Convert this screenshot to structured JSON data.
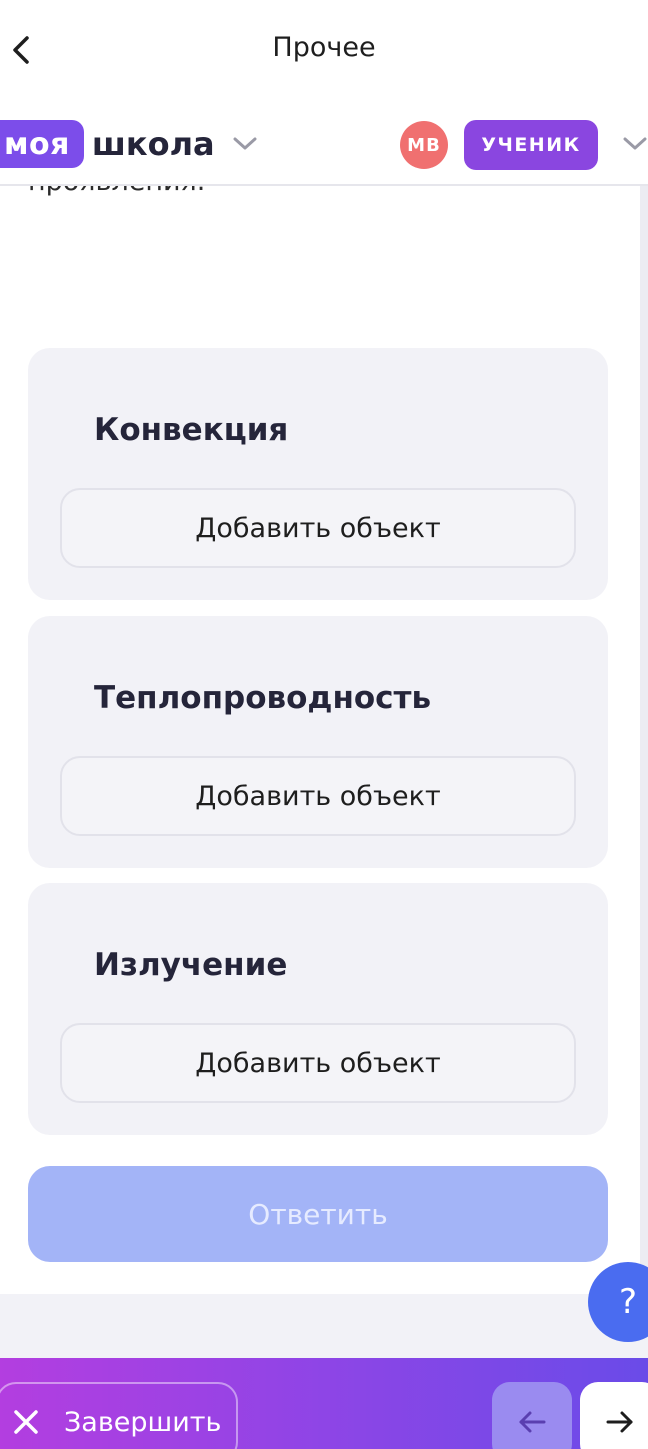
{
  "topbar": {
    "title": "Прочее"
  },
  "header": {
    "logo_part1": "моя",
    "logo_part2": "школа",
    "avatar_initials": "МВ",
    "role": "УЧЕНИК"
  },
  "content": {
    "partial_text": "проявления.",
    "groups": [
      {
        "title": "Конвекция",
        "add_label": "Добавить объект"
      },
      {
        "title": "Теплопроводность",
        "add_label": "Добавить объект"
      },
      {
        "title": "Излучение",
        "add_label": "Добавить объект"
      }
    ],
    "answer_label": "Ответить"
  },
  "help": {
    "label": "?"
  },
  "bottombar": {
    "finish_label": "Завершить"
  },
  "colors": {
    "brand_purple": "#7c4dea",
    "role_badge": "#8a46e0",
    "avatar": "#f07070",
    "answer_disabled": "#a3b4f7",
    "help": "#4a6cf0"
  },
  "icons": {
    "back": "chevron-left-icon",
    "dropdown": "chevron-down-icon",
    "close": "close-icon",
    "prev": "arrow-left-icon",
    "next": "arrow-right-icon"
  }
}
